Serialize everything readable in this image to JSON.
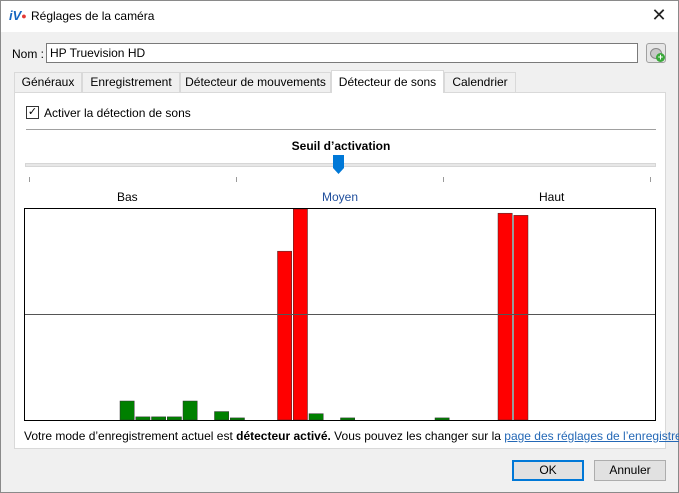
{
  "window": {
    "title": "Réglages de la caméra",
    "close_glyph": "✕",
    "app_icon": "iv-logo-icon"
  },
  "name": {
    "label": "Nom :",
    "value": "HP Truevision HD"
  },
  "tabs": [
    "Généraux",
    "Enregistrement",
    "Détecteur de mouvements",
    "Détecteur de sons",
    "Calendrier"
  ],
  "active_tab": "Détecteur de sons",
  "sound": {
    "checkbox_label": "Activer la détection de sons",
    "checked": true,
    "slider_title": "Seuil d’activation",
    "level_low": "Bas",
    "level_mid": "Moyen",
    "level_high": "Haut",
    "threshold_fraction": 0.5
  },
  "chart_data": {
    "type": "bar",
    "title": "",
    "xlabel": "",
    "ylabel": "",
    "ylim": [
      0,
      1
    ],
    "threshold": 0.5,
    "below_color": "#008000",
    "above_color": "#ff0000",
    "values": [
      0,
      0,
      0,
      0,
      0,
      0,
      0.09,
      0.015,
      0.015,
      0.015,
      0.09,
      0,
      0.04,
      0.01,
      0,
      0,
      0.8,
      1.0,
      0.03,
      0,
      0.01,
      0,
      0,
      0,
      0,
      0,
      0.01,
      0,
      0,
      0,
      0.98,
      0.97,
      0,
      0,
      0,
      0,
      0,
      0,
      0,
      0
    ]
  },
  "footer": {
    "prefix": "Votre mode d’enregistrement actuel est ",
    "mode": "détecteur activé.",
    "middle": " Vous pouvez les changer sur la ",
    "link": "page des réglages de l’enregistrement",
    "suffix": "."
  },
  "buttons": {
    "ok": "OK",
    "cancel": "Annuler"
  }
}
